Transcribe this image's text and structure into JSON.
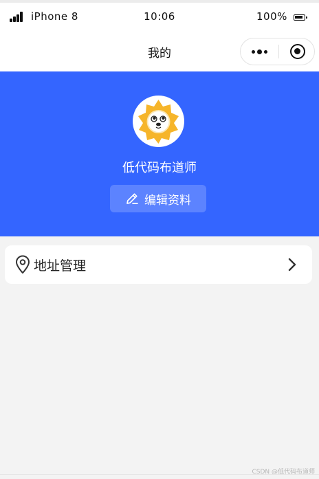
{
  "status_bar": {
    "carrier": "iPhone 8",
    "time": "10:06",
    "battery": "100%",
    "icons": [
      "signal-icon",
      "battery-icon"
    ]
  },
  "nav": {
    "title": "我的",
    "capsule_icons": [
      "more-icon",
      "close-target-icon"
    ]
  },
  "profile": {
    "avatar_icon": "lion-avatar-icon",
    "name": "低代码布道师",
    "edit_label": "编辑资料",
    "edit_icon": "pencil-icon",
    "background_color": "#3465ff"
  },
  "menu": {
    "items": [
      {
        "label": "地址管理",
        "icon": "location-pin-icon",
        "arrow_icon": "chevron-right-icon"
      }
    ]
  },
  "footer": {
    "watermark": "CSDN @低代码布道师"
  }
}
